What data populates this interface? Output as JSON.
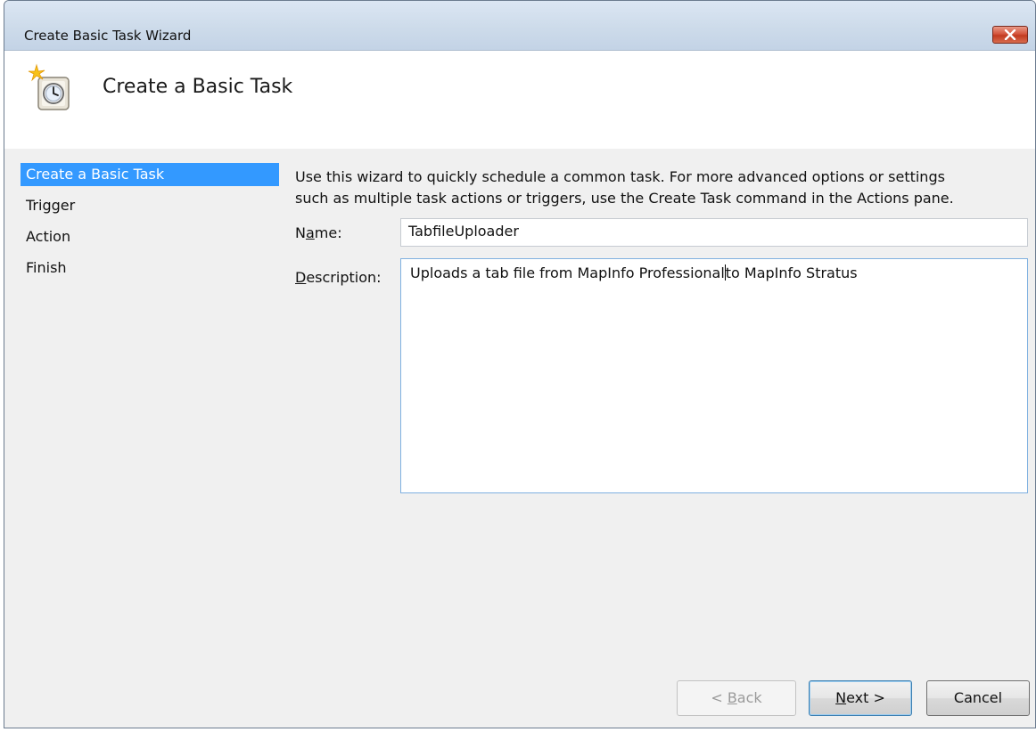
{
  "window": {
    "title": "Create Basic Task Wizard",
    "close_icon": "close-icon"
  },
  "header": {
    "title": "Create a Basic Task",
    "icon": "task-scheduler-icon"
  },
  "nav": {
    "items": [
      {
        "label": "Create a Basic Task",
        "active": true
      },
      {
        "label": "Trigger",
        "active": false
      },
      {
        "label": "Action",
        "active": false
      },
      {
        "label": "Finish",
        "active": false
      }
    ]
  },
  "intro": {
    "line1": "Use this wizard to quickly schedule a common task.  For more advanced options or settings",
    "line2": "such as multiple task actions or triggers, use the Create Task command in the Actions pane."
  },
  "form": {
    "name_label_prefix": "N",
    "name_label_ul": "a",
    "name_label_suffix": "me:",
    "name_value": "TabfileUploader",
    "desc_label_ul": "D",
    "desc_label_suffix": "escription:",
    "desc_value_before_caret": "Uploads a tab file from MapInfo Professional",
    "desc_value_after_caret": "to MapInfo Stratus"
  },
  "buttons": {
    "back_prefix": "< ",
    "back_ul": "B",
    "back_suffix": "ack",
    "next_ul": "N",
    "next_suffix": "ext >",
    "cancel": "Cancel"
  },
  "colors": {
    "selection": "#3399ff",
    "close_button": "#c23a1f"
  }
}
